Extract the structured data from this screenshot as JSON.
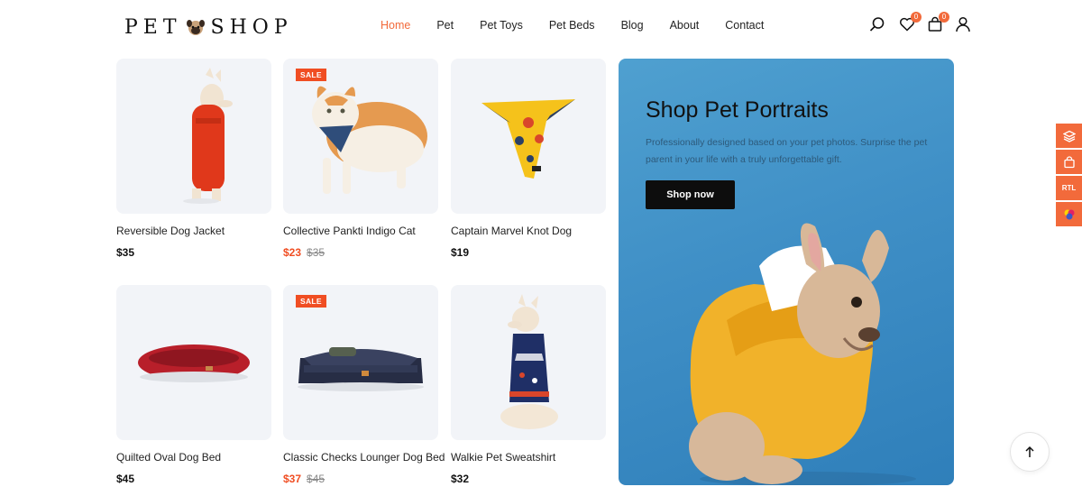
{
  "brand": {
    "logo_left": "PET",
    "logo_right": "SHOP"
  },
  "nav": {
    "items": [
      {
        "label": "Home",
        "active": true
      },
      {
        "label": "Pet",
        "active": false
      },
      {
        "label": "Pet Toys",
        "active": false
      },
      {
        "label": "Pet Beds",
        "active": false
      },
      {
        "label": "Blog",
        "active": false
      },
      {
        "label": "About",
        "active": false
      },
      {
        "label": "Contact",
        "active": false
      }
    ]
  },
  "header_icons": {
    "wishlist_count": "0",
    "cart_count": "0"
  },
  "products": [
    {
      "title": "Reversible Dog Jacket",
      "price": "$35",
      "old_price": "",
      "sale": false
    },
    {
      "title": "Collective Pankti Indigo Cat",
      "price": "$23",
      "old_price": "$35",
      "sale": true
    },
    {
      "title": "Captain Marvel Knot Dog",
      "price": "$19",
      "old_price": "",
      "sale": false
    },
    {
      "title": "Quilted Oval Dog Bed",
      "price": "$45",
      "old_price": "",
      "sale": false
    },
    {
      "title": "Classic Checks Lounger Dog Bed",
      "price": "$37",
      "old_price": "$45",
      "sale": true
    },
    {
      "title": "Walkie Pet Sweatshirt",
      "price": "$32",
      "old_price": "",
      "sale": false
    }
  ],
  "sale_badge": "SALE",
  "promo": {
    "title": "Shop Pet Portraits",
    "description": "Professionally designed based on your pet photos. Surprise the pet parent in your life with a truly unforgettable gift.",
    "button": "Shop now"
  },
  "side_toolbar": {
    "rtl_label": "RTL"
  },
  "colors": {
    "accent": "#f26a3b",
    "sale": "#f04e23",
    "card_bg": "#f2f4f8",
    "promo_bg": "#3f8fc6"
  }
}
